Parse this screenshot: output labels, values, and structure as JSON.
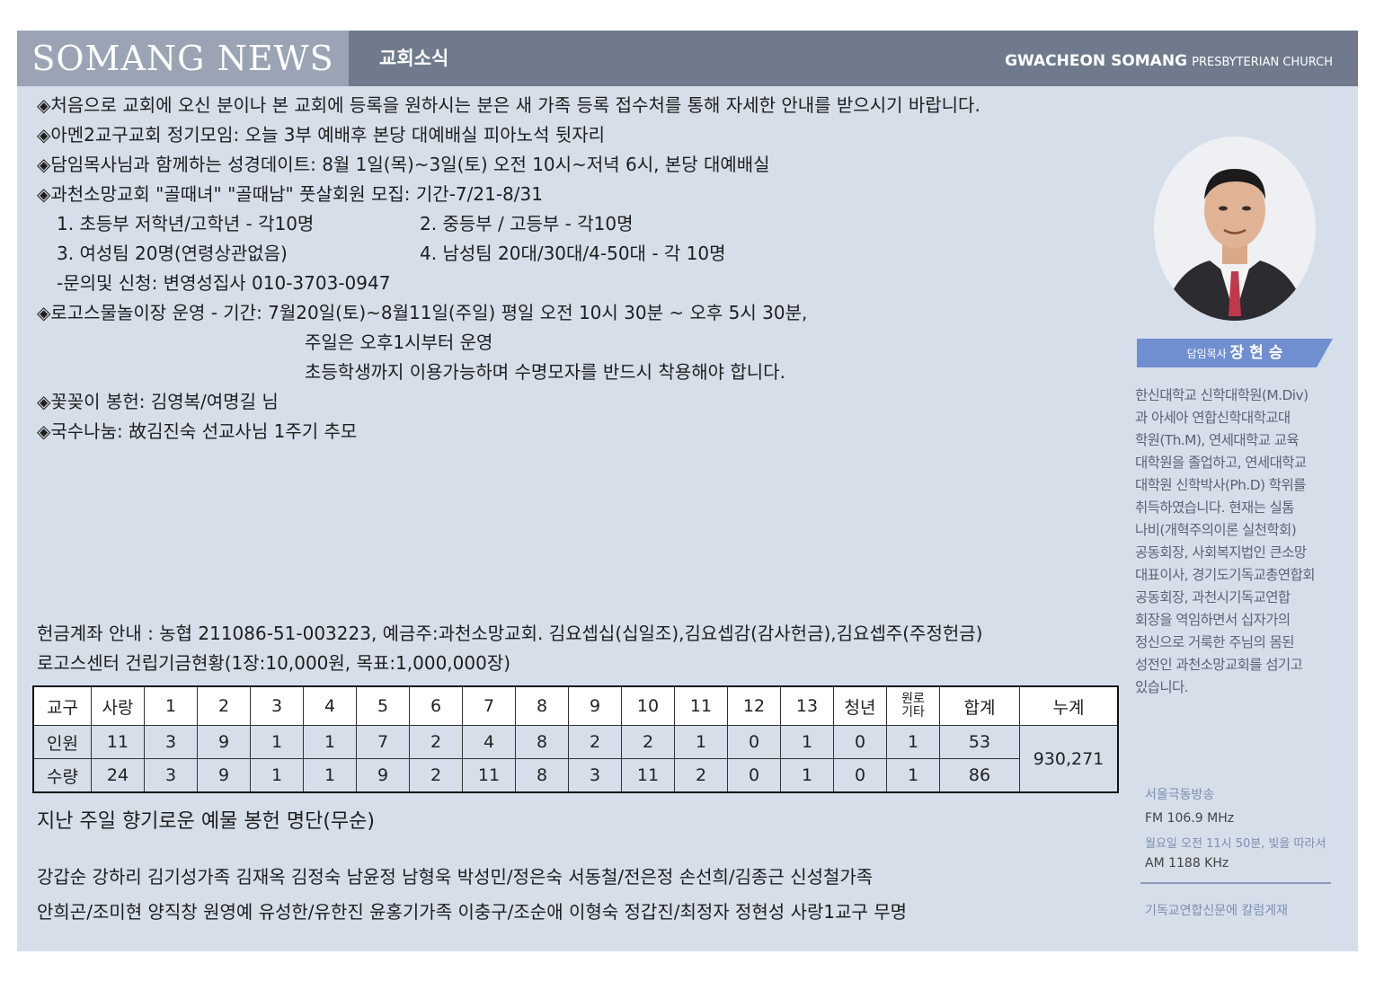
{
  "header": {
    "brand": "SOMANG NEWS",
    "section_title": "교회소식",
    "church_bold": "GWACHEON SOMANG",
    "church_rest": "PRESBYTERIAN CHURCH"
  },
  "notices": {
    "l1": "◈처음으로 교회에 오신 분이나 본 교회에 등록을 원하시는 분은 새 가족 등록 접수처를 통해 자세한 안내를 받으시기 바랍니다.",
    "l2": "◈아멘2교구교회 정기모임: 오늘 3부 예배후 본당 대예배실 피아노석 뒷자리",
    "l3": "◈담임목사님과 함께하는 성경데이트: 8월 1일(목)~3일(토) 오전 10시~저녁 6시, 본당 대예배실",
    "l4": "◈과천소망교회 \"골때녀\" \"골때남\" 풋살회원 모집: 기간-7/21-8/31",
    "l5a": "1. 초등부 저학년/고학년 - 각10명",
    "l5b": "2. 중등부 / 고등부 - 각10명",
    "l6a": "3. 여성팀 20명(연령상관없음)",
    "l6b": "4. 남성팀 20대/30대/4-50대 - 각 10명",
    "l7": "-문의및 신청: 변영성집사 010-3703-0947",
    "l8": "◈로고스물놀이장 운영 - 기간: 7월20일(토)~8월11일(주일) 평일 오전 10시 30분 ~ 오후 5시 30분,",
    "l9": "주일은 오후1시부터 운영",
    "l10": "초등학생까지 이용가능하며 수명모자를 반드시 착용해야 합니다.",
    "l11": "◈꽃꽂이 봉헌: 김영복/여명길 님",
    "l12": "◈국수나눔: 故김진숙 선교사님 1주기 추모"
  },
  "offering": {
    "account": "헌금계좌 안내 : 농협 211086-51-003223, 예금주:과천소망교회. 김요셉십(십일조),김요셉감(감사헌금),김요셉주(주정헌금)",
    "fund": "로고스센터 건립기금현황(1장:10,000원, 목표:1,000,000장)"
  },
  "fund_table": {
    "headers": [
      "교구",
      "사랑",
      "1",
      "2",
      "3",
      "4",
      "5",
      "6",
      "7",
      "8",
      "9",
      "10",
      "11",
      "12",
      "13",
      "청년",
      "원로\n기타",
      "합계",
      "누계"
    ],
    "header_elder_1": "원로",
    "header_elder_2": "기타",
    "rows": [
      {
        "label": "인원",
        "cells": [
          "11",
          "3",
          "9",
          "1",
          "1",
          "7",
          "2",
          "4",
          "8",
          "2",
          "2",
          "1",
          "0",
          "1",
          "0",
          "1",
          "53"
        ]
      },
      {
        "label": "수량",
        "cells": [
          "24",
          "3",
          "9",
          "1",
          "1",
          "9",
          "2",
          "11",
          "8",
          "3",
          "11",
          "2",
          "0",
          "1",
          "0",
          "1",
          "86"
        ]
      }
    ],
    "cumulative": "930,271"
  },
  "donors": {
    "title": "지난 주일 향기로운 예물 봉헌 명단(무순)",
    "line1": "강갑순 강하리 김기성가족 김재옥 김정숙 남윤정 남형욱 박성민/정은숙 서동철/전은정 손선희/김종근 신성철가족",
    "line2": "안희곤/조미현 양직창 원영예 유성한/유한진 윤홍기가족 이충구/조순애 이형숙 정갑진/최정자 정현성 사랑1교구 무명"
  },
  "pastor": {
    "title_small": "담임목사",
    "name": "장 현 승",
    "bio": [
      "한신대학교 신학대학원(M.Div)",
      "과 아세아 연합신학대학교대",
      "학원(Th.M), 연세대학교 교육",
      "대학원을 졸업하고, 연세대학교",
      "대학원 신학박사(Ph.D) 학위를",
      "취득하였습니다. 현재는 실톰",
      "나비(개혁주의이론 실천학회)",
      "공동회장, 사회복지법인 큰소망",
      "대표이사, 경기도기독교총연합회",
      "공동회장, 과천시기독교연합",
      "회장을 역임하면서 십자가의",
      "정신으로 거룩한 주님의 몸된",
      "성전인 과천소망교회를 섬기고",
      "있습니다."
    ],
    "radio_name": "서울극동방송",
    "radio_fm": "FM 106.9 MHz",
    "radio_time": "월요일 오전 11시 50분, 빛을 따라서",
    "radio_am": "AM 1188 KHz",
    "column_note": "기독교연합신문에 칼럼게재"
  },
  "colors": {
    "header_dark": "#6f7b8c",
    "header_light": "#9aa4b4",
    "background": "#d6deea",
    "banner_blue": "#6f8fd0"
  }
}
